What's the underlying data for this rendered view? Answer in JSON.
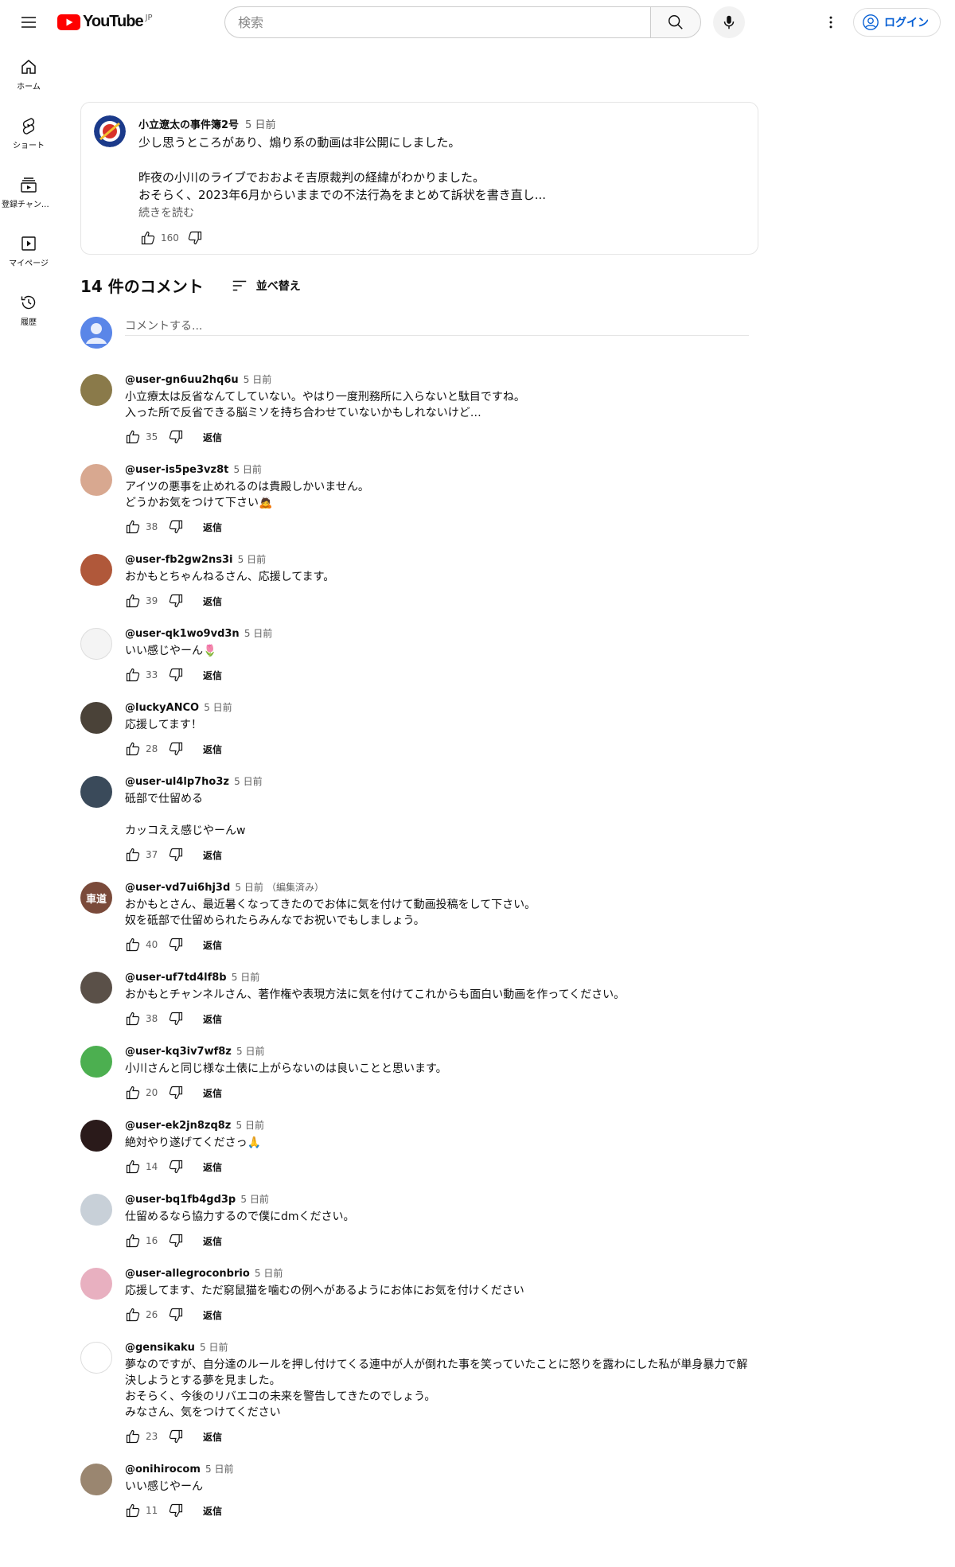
{
  "header": {
    "logo_text": "YouTube",
    "region": "JP",
    "search_placeholder": "検索",
    "login_label": "ログイン"
  },
  "sidebar": {
    "items": [
      {
        "label": "ホーム",
        "icon": "home-icon"
      },
      {
        "label": "ショート",
        "icon": "shorts-icon"
      },
      {
        "label": "登録チャンネル",
        "icon": "subscriptions-icon"
      },
      {
        "label": "マイページ",
        "icon": "library-icon"
      },
      {
        "label": "履歴",
        "icon": "history-icon"
      }
    ]
  },
  "post": {
    "author": "小立遼太の事件簿2号",
    "time": "5 日前",
    "lines": [
      "少し思うところがあり、煽り系の動画は非公開にしました。",
      "",
      "昨夜の小川のライブでおおよそ吉原裁判の経緯がわかりました。",
      "おそらく、2023年6月からいままでの不法行為をまとめて訴状を書き直し..."
    ],
    "read_more": "続きを読む",
    "likes": "160"
  },
  "comments_section": {
    "count_label": "14 件のコメント",
    "sort_label": "並べ替え",
    "add_placeholder": "コメントする..."
  },
  "reply_label": "返信",
  "comments": [
    {
      "author": "@user-gn6uu2hq6u",
      "time": "5 日前",
      "edited": "",
      "lines": [
        "小立療太は反省なんてしていない。やはり一度刑務所に入らないと駄目ですね。",
        "入った所で反省できる脳ミソを持ち合わせていないかもしれないけど…"
      ],
      "likes": "35",
      "avatar_color": "#8a7a4a"
    },
    {
      "author": "@user-is5pe3vz8t",
      "time": "5 日前",
      "edited": "",
      "lines": [
        "アイツの悪事を止めれるのは貴殿しかいません。",
        "どうかお気をつけて下さい🙇"
      ],
      "likes": "38",
      "avatar_color": "#d8a890"
    },
    {
      "author": "@user-fb2gw2ns3i",
      "time": "5 日前",
      "edited": "",
      "lines": [
        "おかもとちゃんねるさん、応援してます。"
      ],
      "likes": "39",
      "avatar_color": "#b0583a"
    },
    {
      "author": "@user-qk1wo9vd3n",
      "time": "5 日前",
      "edited": "",
      "lines": [
        "いい感じやーん🌷"
      ],
      "likes": "33",
      "avatar_color": "#f4f4f4"
    },
    {
      "author": "@luckyANCO",
      "time": "5 日前",
      "edited": "",
      "lines": [
        "応援してます！"
      ],
      "likes": "28",
      "avatar_color": "#4a4238"
    },
    {
      "author": "@user-ul4lp7ho3z",
      "time": "5 日前",
      "edited": "",
      "lines": [
        "砥部で仕留める",
        "",
        "カッコええ感じやーんw"
      ],
      "likes": "37",
      "avatar_color": "#3a4a5a"
    },
    {
      "author": "@user-vd7ui6hj3d",
      "time": "5 日前",
      "edited": "（編集済み）",
      "lines": [
        "おかもとさん、最近暑くなってきたのでお体に気を付けて動画投稿をして下さい。",
        "奴を砥部で仕留められたらみんなでお祝いでもしましょう。"
      ],
      "likes": "40",
      "avatar_color": "#7a4a3a",
      "avatar_text": "車道"
    },
    {
      "author": "@user-uf7td4lf8b",
      "time": "5 日前",
      "edited": "",
      "lines": [
        "おかもとチャンネルさん、著作権や表現方法に気を付けてこれからも面白い動画を作ってください。"
      ],
      "likes": "38",
      "avatar_color": "#5a5048"
    },
    {
      "author": "@user-kq3iv7wf8z",
      "time": "5 日前",
      "edited": "",
      "lines": [
        "小川さんと同じ様な土俵に上がらないのは良いことと思います。"
      ],
      "likes": "20",
      "avatar_color": "#4caf50"
    },
    {
      "author": "@user-ek2jn8zq8z",
      "time": "5 日前",
      "edited": "",
      "lines": [
        "絶対やり遂げてくださっ🙏"
      ],
      "likes": "14",
      "avatar_color": "#2a1a1a"
    },
    {
      "author": "@user-bq1fb4gd3p",
      "time": "5 日前",
      "edited": "",
      "lines": [
        "仕留めるなら協力するので僕にdmください。"
      ],
      "likes": "16",
      "avatar_color": "#c8d0d8"
    },
    {
      "author": "@user-allegroconbrio",
      "time": "5 日前",
      "edited": "",
      "lines": [
        "応援してます、ただ窮鼠猫を噛むの例へがあるようにお体にお気を付けください"
      ],
      "likes": "26",
      "avatar_color": "#e8b0c0"
    },
    {
      "author": "@gensikaku",
      "time": "5 日前",
      "edited": "",
      "lines": [
        "夢なのですが、自分達のルールを押し付けてくる連中が人が倒れた事を笑っていたことに怒りを露わにした私が単身暴力で解",
        "決しようとする夢を見ました。",
        "おそらく、今後のリバエコの未来を警告してきたのでしょう。",
        "みなさん、気をつけてください"
      ],
      "likes": "23",
      "avatar_color": "#ffffff"
    },
    {
      "author": "@onihirocom",
      "time": "5 日前",
      "edited": "",
      "lines": [
        "いい感じやーん"
      ],
      "likes": "11",
      "avatar_color": "#9a8670"
    }
  ]
}
